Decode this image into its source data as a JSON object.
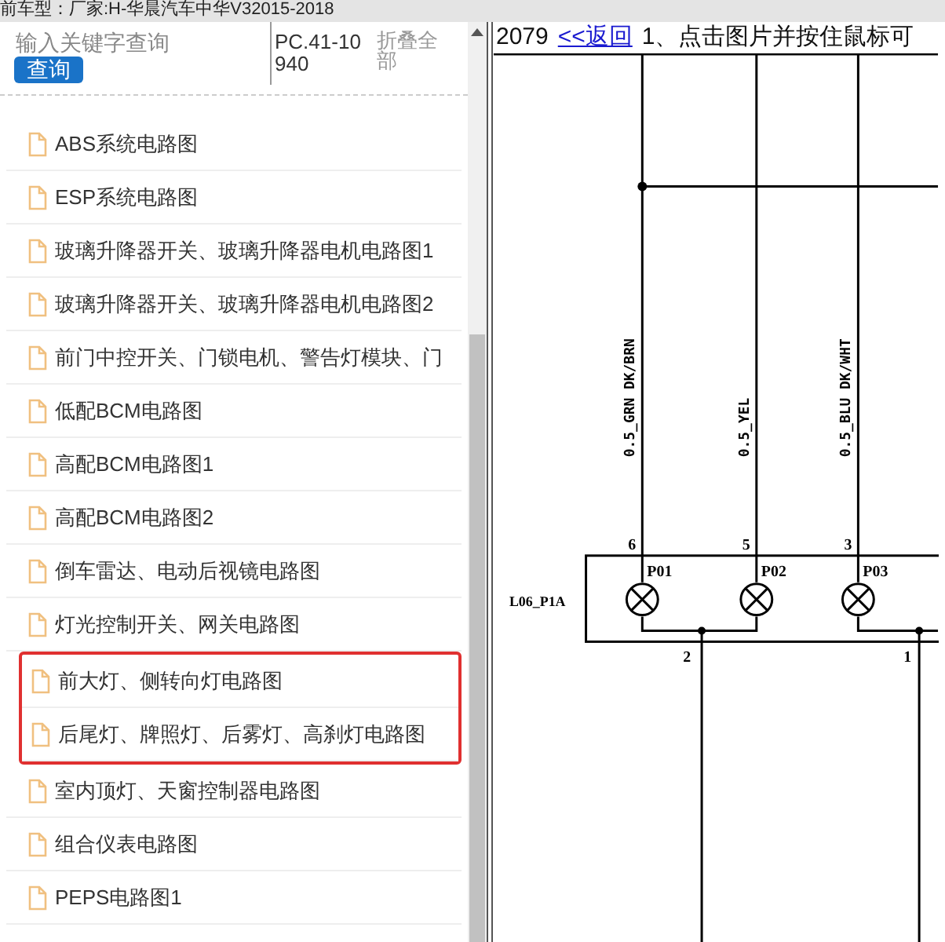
{
  "header": {
    "text": "前车型：厂家:H-华晨汽车中华V32015-2018"
  },
  "search": {
    "placeholder": "输入关键字查询",
    "button": "查询"
  },
  "code": "PC.41-10940",
  "collapse_all": "折叠全部",
  "items": [
    {
      "label": "ABS系统电路图",
      "highlighted": false
    },
    {
      "label": "ESP系统电路图",
      "highlighted": false
    },
    {
      "label": "玻璃升降器开关、玻璃升降器电机电路图1",
      "highlighted": false
    },
    {
      "label": "玻璃升降器开关、玻璃升降器电机电路图2",
      "highlighted": false
    },
    {
      "label": "前门中控开关、门锁电机、警告灯模块、门",
      "highlighted": false
    },
    {
      "label": "低配BCM电路图",
      "highlighted": false
    },
    {
      "label": "高配BCM电路图1",
      "highlighted": false
    },
    {
      "label": "高配BCM电路图2",
      "highlighted": false
    },
    {
      "label": "倒车雷达、电动后视镜电路图",
      "highlighted": false
    },
    {
      "label": "灯光控制开关、网关电路图",
      "highlighted": false
    },
    {
      "label": "前大灯、侧转向灯电路图",
      "highlighted": true
    },
    {
      "label": "后尾灯、牌照灯、后雾灯、高刹灯电路图",
      "highlighted": true
    },
    {
      "label": "室内顶灯、天窗控制器电路图",
      "highlighted": false
    },
    {
      "label": "组合仪表电路图",
      "highlighted": false
    },
    {
      "label": "PEPS电路图1",
      "highlighted": false
    }
  ],
  "viewer": {
    "page": "2079",
    "back_link": "<<返回",
    "hint": "1、点击图片并按住鼠标可"
  },
  "diagram": {
    "connector": "L06_P1A",
    "wires": [
      "0.5_GRN DK/BRN",
      "0.5_YEL",
      "0.5_BLU DK/WHT"
    ],
    "top_pins": [
      "6",
      "5",
      "3"
    ],
    "lamps": [
      "P01",
      "P02",
      "P03"
    ],
    "bottom_pins": [
      "2",
      "1"
    ]
  }
}
